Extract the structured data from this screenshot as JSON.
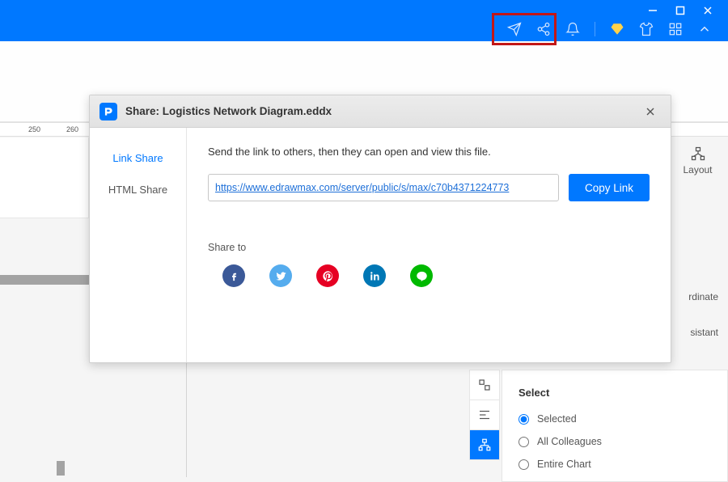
{
  "titlebar": {
    "icons": {
      "send": "send-icon",
      "share": "share-icon",
      "bell": "bell-icon",
      "diamond": "diamond-icon",
      "shirt": "shirt-icon",
      "grid": "grid-icon",
      "chevron": "chevron-up-icon"
    }
  },
  "ruler": {
    "marks": [
      "250",
      "260"
    ]
  },
  "right_top": {
    "layout_label": "Layout"
  },
  "right_labels": {
    "coord": "rdinate",
    "assist": "sistant"
  },
  "select_panel": {
    "title": "Select",
    "options": [
      "Selected",
      "All Colleagues",
      "Entire Chart"
    ],
    "selected_index": 0
  },
  "dialog": {
    "title": "Share: Logistics Network Diagram.eddx",
    "tabs": [
      "Link Share",
      "HTML Share"
    ],
    "active_tab": 0,
    "description": "Send the link to others, then they can open and view this file.",
    "share_url": "https://www.edrawmax.com/server/public/s/max/c70b4371224773",
    "copy_button": "Copy Link",
    "share_to_label": "Share to",
    "socials": [
      {
        "name": "facebook",
        "color": "#3b5998"
      },
      {
        "name": "twitter",
        "color": "#55acee"
      },
      {
        "name": "pinterest",
        "color": "#e60023"
      },
      {
        "name": "linkedin",
        "color": "#0077b5"
      },
      {
        "name": "line",
        "color": "#00b900"
      }
    ]
  }
}
